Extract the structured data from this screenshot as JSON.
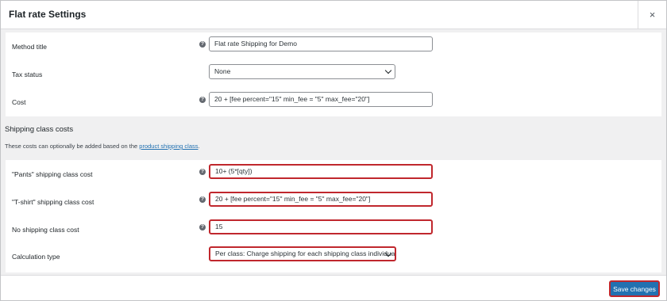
{
  "modal": {
    "title": "Flat rate Settings",
    "close_symbol": "×"
  },
  "help_symbol": "?",
  "rows_top": [
    {
      "label": "Method title",
      "value": "Flat rate Shipping for Demo",
      "type": "text"
    },
    {
      "label": "Tax status",
      "value": "None",
      "type": "select"
    },
    {
      "label": "Cost",
      "value": "20 + [fee percent=\"15\" min_fee = \"5\" max_fee=\"20\"]",
      "type": "text"
    }
  ],
  "shipping_class": {
    "title": "Shipping class costs",
    "description_prefix": "These costs can optionally be added based on the ",
    "description_link": "product shipping class",
    "description_suffix": "."
  },
  "rows_bottom": [
    {
      "label": "\"Pants\" shipping class cost",
      "value": "10+ (5*[qty])",
      "type": "text"
    },
    {
      "label": "\"T-shirt\" shipping class cost",
      "value": "20 + [fee percent=\"15\" min_fee = \"5\" max_fee=\"20\"]",
      "type": "text"
    },
    {
      "label": "No shipping class cost",
      "value": "15",
      "type": "text"
    },
    {
      "label": "Calculation type",
      "value": "Per class: Charge shipping for each shipping class individually",
      "type": "select"
    }
  ],
  "footer": {
    "save_label": "Save changes"
  },
  "colors": {
    "primary": "#2271b1",
    "highlight_border": "#c0272d",
    "body_bg": "#f0f0f1"
  }
}
